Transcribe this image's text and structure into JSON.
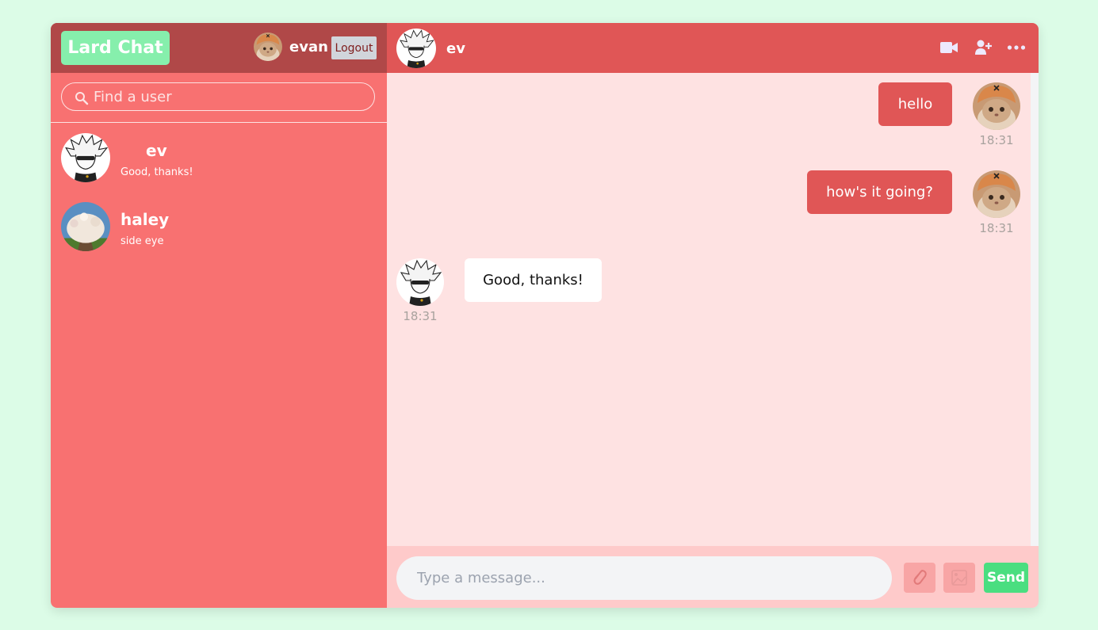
{
  "app": {
    "brand": "Lard Chat"
  },
  "user": {
    "name": "evan",
    "logout_label": "Logout",
    "avatar": "cat-avatar"
  },
  "search": {
    "placeholder": "Find a user",
    "icon": "search-icon"
  },
  "chats": [
    {
      "name": "ev",
      "last_message": "Good, thanks!",
      "avatar": "anime-avatar"
    },
    {
      "name": "haley",
      "last_message": "side eye",
      "avatar": "tree-avatar"
    }
  ],
  "conversation": {
    "peer_name": "ev",
    "icons": [
      "video-icon",
      "add-user-icon",
      "more-icon"
    ],
    "messages": [
      {
        "text": "hello",
        "time": "18:31",
        "own": true
      },
      {
        "text": "how's it going?",
        "time": "18:31",
        "own": true
      },
      {
        "text": "Good, thanks!",
        "time": "18:31",
        "own": false
      }
    ]
  },
  "composer": {
    "placeholder": "Type a message...",
    "send_label": "Send",
    "icons": [
      "attach-icon",
      "image-icon"
    ]
  },
  "colors": {
    "background": "#dcfce7",
    "sidebar": "#f87171",
    "sidebar_header": "#b04848",
    "chat_header": "#e05656",
    "chat_bg": "#fee2e2",
    "brand": "#86efac",
    "send": "#4ade80"
  }
}
